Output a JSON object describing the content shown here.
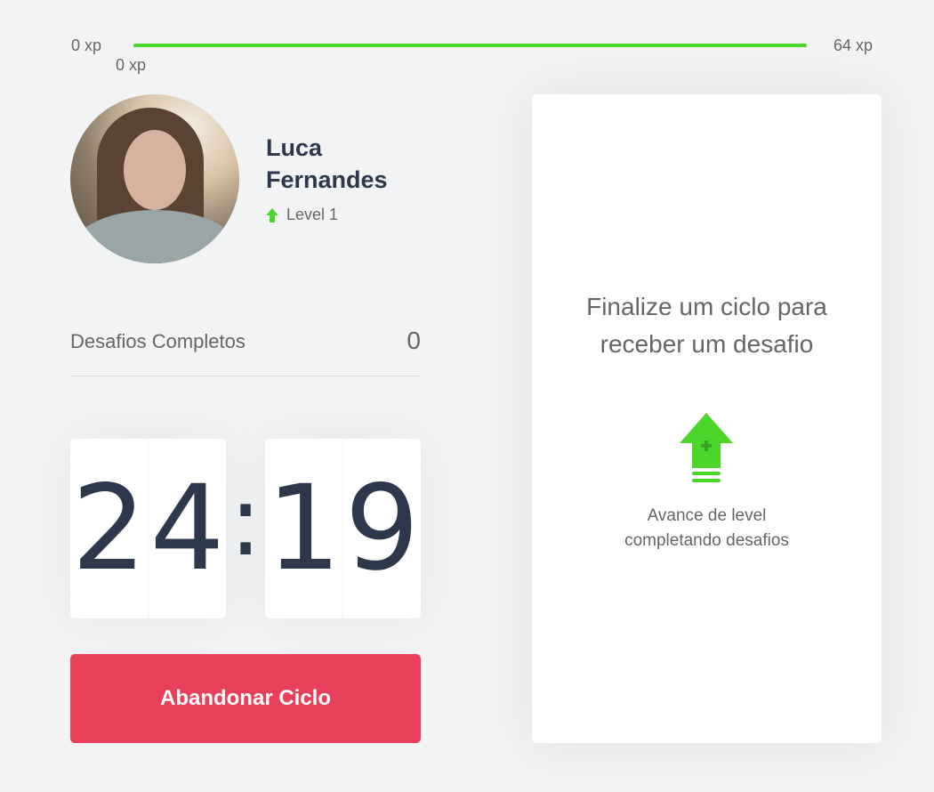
{
  "xp": {
    "min_label": "0 xp",
    "max_label": "64 xp",
    "current_label": "0 xp",
    "progress_fraction": 1.0,
    "fill_color": "#4cd62b"
  },
  "profile": {
    "name": "Luca Fernandes",
    "level_label": "Level 1",
    "level_icon": "level-up-arrow-icon",
    "avatar_icon": "user-avatar-photo"
  },
  "challenges": {
    "label": "Desafios Completos",
    "count": "0"
  },
  "countdown": {
    "minute_tens": "2",
    "minute_ones": "4",
    "separator": ":",
    "second_tens": "1",
    "second_ones": "9"
  },
  "cycle_button": {
    "label": "Abandonar Ciclo",
    "color": "#e83f5b"
  },
  "challenge_box": {
    "title": "Finalize um ciclo para receber um desafio",
    "hint": "Avance de level completando desafios",
    "icon": "level-up-icon"
  },
  "colors": {
    "background": "#f2f3f5",
    "title_text": "#2e384d",
    "text": "#666666",
    "green": "#4cd62b",
    "red": "#e83f5b"
  }
}
